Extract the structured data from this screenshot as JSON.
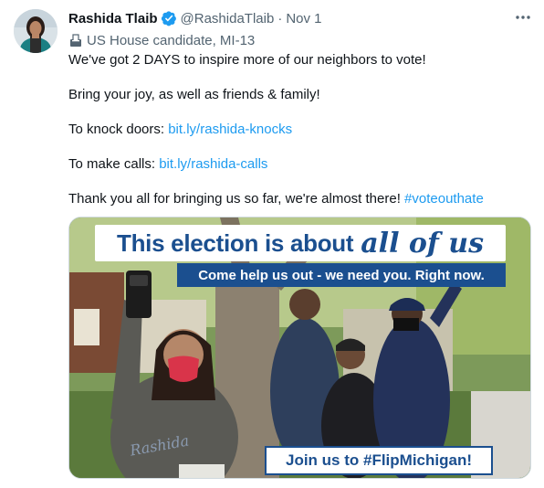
{
  "author": {
    "name": "Rashida Tlaib",
    "handle": "@RashidaTlaib",
    "separator": "·",
    "date": "Nov 1",
    "verified": true
  },
  "label": {
    "icon": "ballot-box-icon",
    "text": "US House candidate, MI-13"
  },
  "tweet": {
    "line1": "We've got 2 DAYS to inspire more of our neighbors to vote!",
    "line2": "Bring your joy, as well as friends & family!",
    "line3_prefix": "To knock doors: ",
    "line3_link": "bit.ly/rashida-knocks",
    "line4_prefix": "To make calls: ",
    "line4_link": "bit.ly/rashida-calls",
    "line5_prefix": "Thank you all for bringing us so far, we're almost there! ",
    "line5_hashtag": "#voteouthate"
  },
  "media": {
    "title_main": "This election is about",
    "title_emphasis": "all of us",
    "subtitle": "Come help us out - we need you. Right now.",
    "cta": "Join us to #FlipMichigan!",
    "shirt_text": "Rashida"
  },
  "colors": {
    "link": "#1d9bf0",
    "verified": "#1d9bf0",
    "banner_blue": "#1b4f8f",
    "secondary_text": "#536471"
  }
}
